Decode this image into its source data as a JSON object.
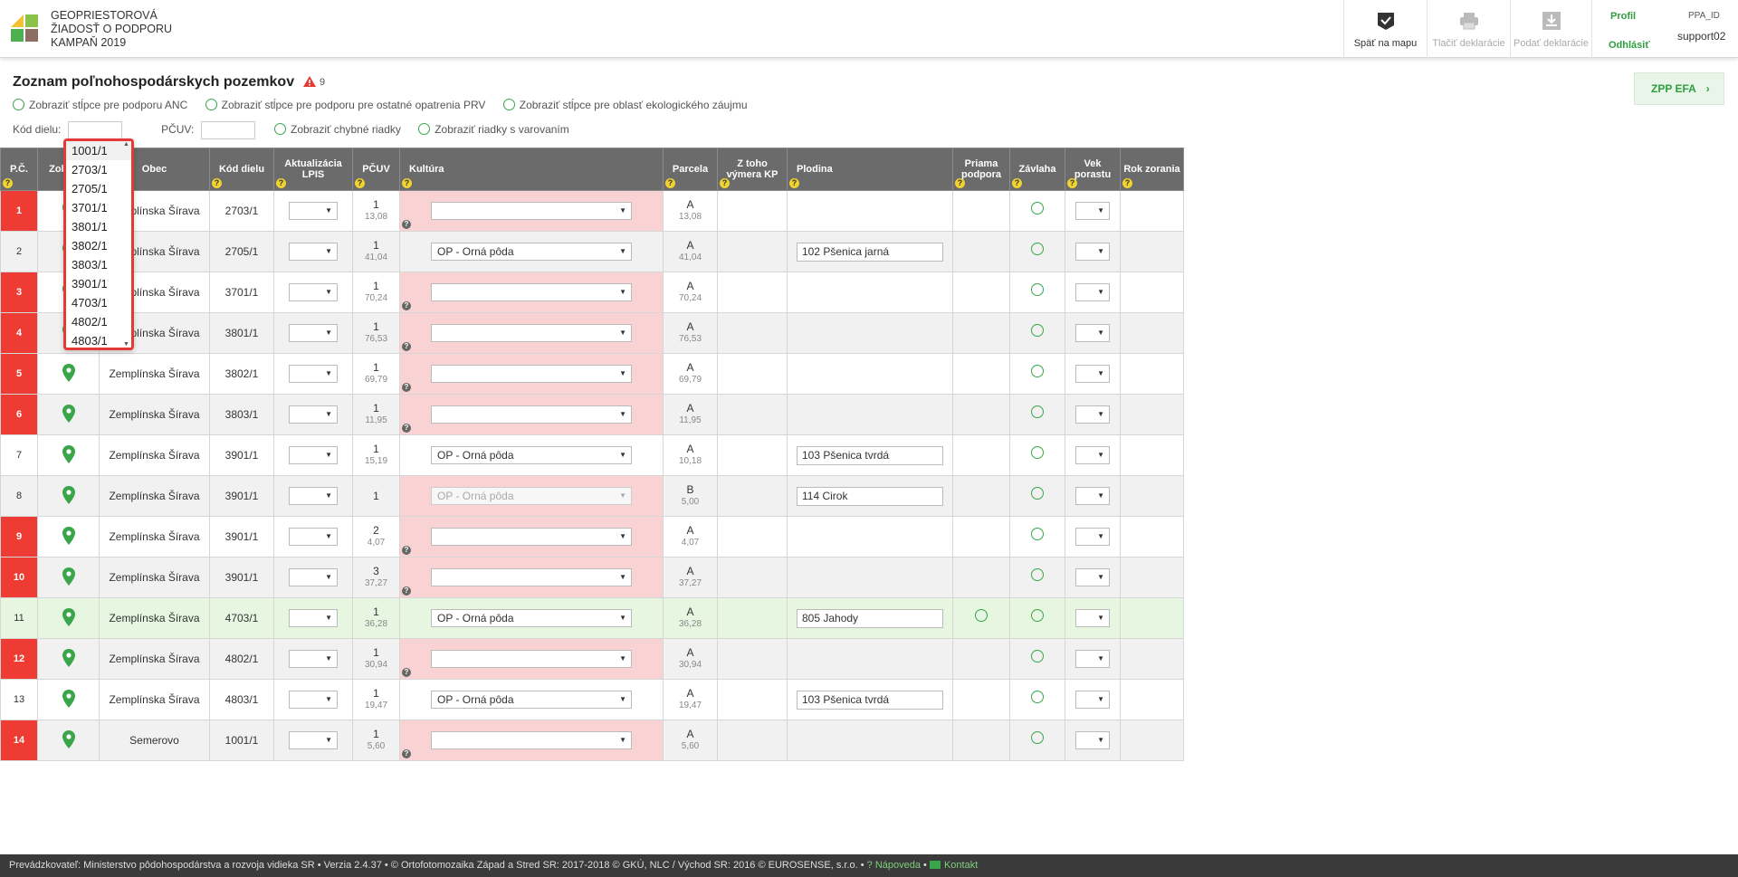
{
  "app": {
    "brand_line1": "GEOPRIESTOROVÁ",
    "brand_line2": "ŽIADOSŤ O PODPORU",
    "brand_line3": "KAMPAŇ 2019"
  },
  "header_buttons": {
    "back_to_map": "Späť na mapu",
    "print": "Tlačiť deklarácie",
    "submit": "Podať deklarácie"
  },
  "profile": {
    "profile_label": "Profil",
    "logout_label": "Odhlásiť",
    "id_label": "PPA_ID",
    "user": "support02"
  },
  "page": {
    "title": "Zoznam poľnohospodárskych pozemkov",
    "warning_count": "9",
    "zpp_button": "ZPP EFA"
  },
  "toggles": {
    "anc": "Zobraziť stĺpce pre podporu ANC",
    "prv": "Zobraziť stĺpce pre podporu pre ostatné opatrenia PRV",
    "efa": "Zobraziť stĺpce pre oblasť ekologického záujmu",
    "error_rows": "Zobraziť chybné riadky",
    "warning_rows": "Zobraziť riadky s varovaním"
  },
  "filters": {
    "kod_dielu_label": "Kód dielu:",
    "pcuv_label": "PČUV:"
  },
  "columns": {
    "pc": "P.Č.",
    "zobrazit": "Zobr. na",
    "obec": "Obec",
    "kod_dielu": "Kód dielu",
    "aktualizacia": "Aktualizácia LPIS",
    "pcuv": "PČUV",
    "kultura": "Kultúra",
    "parcela": "Parcela",
    "vymera": "Z toho výmera KP",
    "plodina": "Plodina",
    "priama": "Priama podpora",
    "zavlaha": "Závlaha",
    "vek": "Vek porastu",
    "rok": "Rok zorania"
  },
  "rows": [
    {
      "nr": "1",
      "obec": "Zemplínska Šírava",
      "kod": "2703/1",
      "pcuv": "1",
      "pcuv_area": "13,08",
      "kultura": "",
      "parcela": "A",
      "parcela_area": "13,08",
      "plodina": ""
    },
    {
      "nr": "2",
      "obec": "Zemplínska Šírava",
      "kod": "2705/1",
      "pcuv": "1",
      "pcuv_area": "41,04",
      "kultura": "OP - Orná pôda",
      "parcela": "A",
      "parcela_area": "41,04",
      "plodina": "102  Pšenica jarná"
    },
    {
      "nr": "3",
      "obec": "Zemplínska Šírava",
      "kod": "3701/1",
      "pcuv": "1",
      "pcuv_area": "70,24",
      "kultura": "",
      "parcela": "A",
      "parcela_area": "70,24",
      "plodina": ""
    },
    {
      "nr": "4",
      "obec": "Zemplínska Šírava",
      "kod": "3801/1",
      "pcuv": "1",
      "pcuv_area": "76,53",
      "kultura": "",
      "parcela": "A",
      "parcela_area": "76,53",
      "plodina": ""
    },
    {
      "nr": "5",
      "obec": "Zemplínska Šírava",
      "kod": "3802/1",
      "pcuv": "1",
      "pcuv_area": "69,79",
      "kultura": "",
      "parcela": "A",
      "parcela_area": "69,79",
      "plodina": ""
    },
    {
      "nr": "6",
      "obec": "Zemplínska Šírava",
      "kod": "3803/1",
      "pcuv": "1",
      "pcuv_area": "11,95",
      "kultura": "",
      "parcela": "A",
      "parcela_area": "11,95",
      "plodina": ""
    },
    {
      "nr": "7",
      "obec": "Zemplínska Šírava",
      "kod": "3901/1",
      "pcuv": "1",
      "pcuv_area": "15,19",
      "kultura": "OP - Orná pôda",
      "parcela": "A",
      "parcela_area": "10,18",
      "plodina": "103  Pšenica tvrdá"
    },
    {
      "nr": "8",
      "obec": "Zemplínska Šírava",
      "kod": "3901/1",
      "pcuv": "1",
      "pcuv_area": "",
      "kultura": "OP - Orná pôda",
      "parcela": "B",
      "parcela_area": "5,00",
      "plodina": "114  Cirok"
    },
    {
      "nr": "9",
      "obec": "Zemplínska Šírava",
      "kod": "3901/1",
      "pcuv": "2",
      "pcuv_area": "4,07",
      "kultura": "",
      "parcela": "A",
      "parcela_area": "4,07",
      "plodina": ""
    },
    {
      "nr": "10",
      "obec": "Zemplínska Šírava",
      "kod": "3901/1",
      "pcuv": "3",
      "pcuv_area": "37,27",
      "kultura": "",
      "parcela": "A",
      "parcela_area": "37,27",
      "plodina": ""
    },
    {
      "nr": "11",
      "obec": "Zemplínska Šírava",
      "kod": "4703/1",
      "pcuv": "1",
      "pcuv_area": "36,28",
      "kultura": "OP - Orná pôda",
      "parcela": "A",
      "parcela_area": "36,28",
      "plodina": "805  Jahody"
    },
    {
      "nr": "12",
      "obec": "Zemplínska Šírava",
      "kod": "4802/1",
      "pcuv": "1",
      "pcuv_area": "30,94",
      "kultura": "",
      "parcela": "A",
      "parcela_area": "30,94",
      "plodina": ""
    },
    {
      "nr": "13",
      "obec": "Zemplínska Šírava",
      "kod": "4803/1",
      "pcuv": "1",
      "pcuv_area": "19,47",
      "kultura": "OP - Orná pôda",
      "parcela": "A",
      "parcela_area": "19,47",
      "plodina": "103  Pšenica tvrdá"
    },
    {
      "nr": "14",
      "obec": "Semerovo",
      "kod": "1001/1",
      "pcuv": "1",
      "pcuv_area": "5,60",
      "kultura": "",
      "parcela": "A",
      "parcela_area": "5,60",
      "plodina": ""
    }
  ],
  "dropdown": {
    "items": [
      "1001/1",
      "2703/1",
      "2705/1",
      "3701/1",
      "3801/1",
      "3802/1",
      "3803/1",
      "3901/1",
      "4703/1",
      "4802/1",
      "4803/1"
    ]
  },
  "footer": {
    "text": "Prevádzkovateľ: Ministerstvo pôdohospodárstva a rozvoja vidieka SR • Verzia 2.4.37 • © Ortofotomozaika Západ a Stred SR: 2017-2018 © GKÚ, NLC / Východ SR: 2016 © EUROSENSE, s.r.o. •",
    "help": "Nápoveda",
    "contact": "Kontakt"
  }
}
